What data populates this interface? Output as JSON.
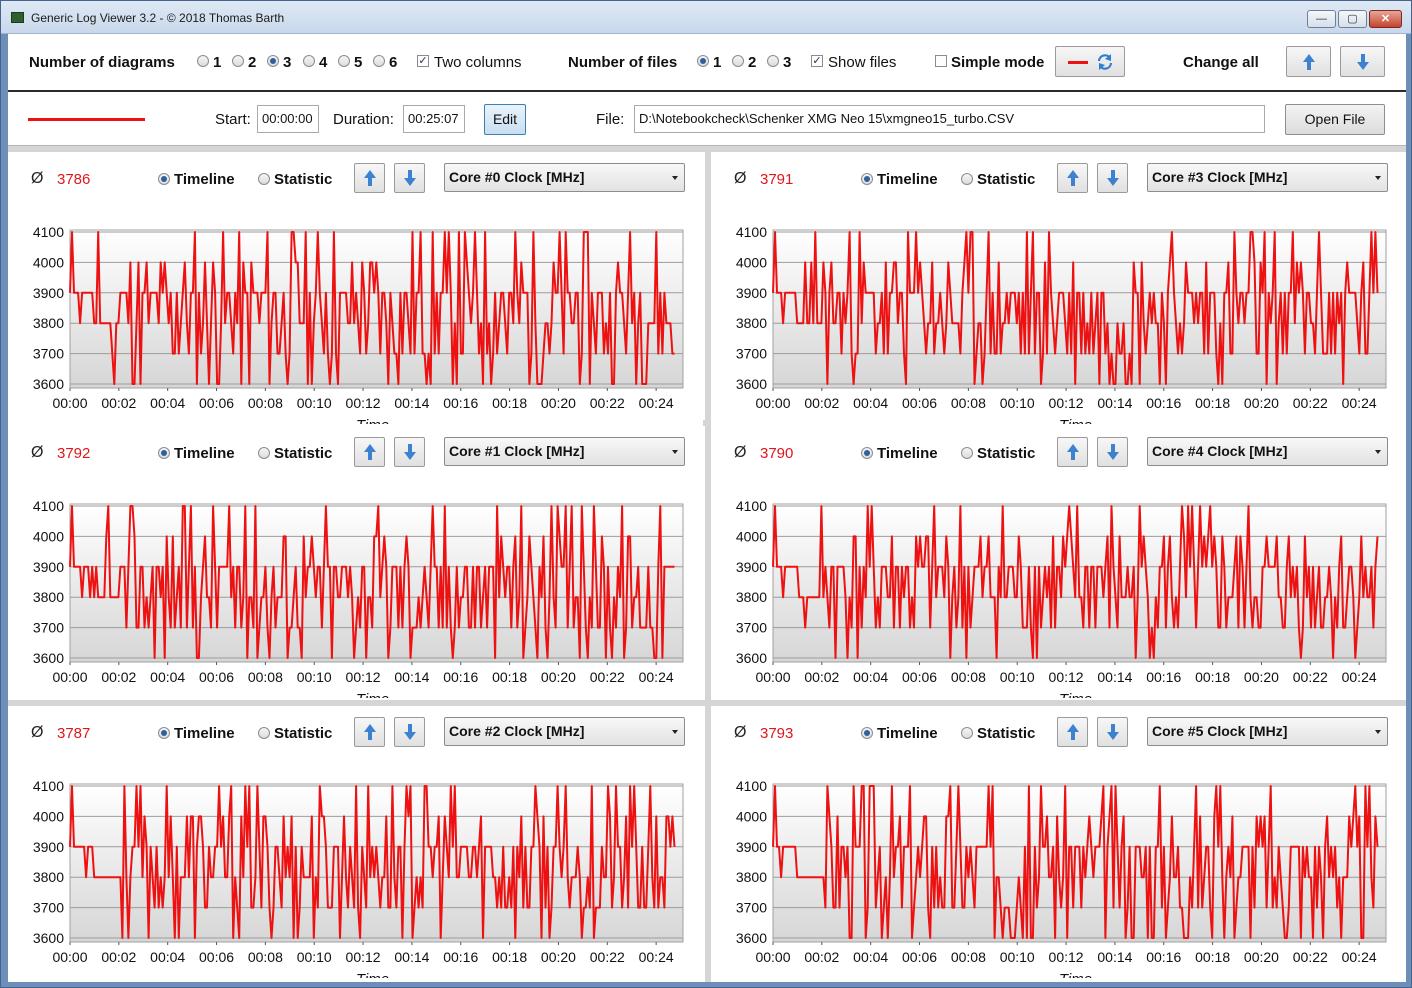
{
  "window": {
    "title": "Generic Log Viewer 3.2 - © 2018 Thomas Barth",
    "min": "—",
    "max": "▢",
    "close": "✕"
  },
  "toolbar": {
    "diagrams_label": "Number of diagrams",
    "diagram_options": [
      "1",
      "2",
      "3",
      "4",
      "5",
      "6"
    ],
    "diagram_selected": "3",
    "two_columns_label": "Two columns",
    "two_columns_checked": true,
    "files_label": "Number of files",
    "file_options": [
      "1",
      "2",
      "3"
    ],
    "file_selected": "1",
    "show_files_label": "Show files",
    "show_files_checked": true,
    "simple_mode_label": "Simple mode",
    "simple_mode_checked": false,
    "change_all_label": "Change all"
  },
  "fileinfo": {
    "start_label": "Start:",
    "start_value": "00:00:00",
    "duration_label": "Duration:",
    "duration_value": "00:25:07",
    "edit_label": "Edit",
    "file_label": "File:",
    "file_path": "D:\\Notebookcheck\\Schenker XMG Neo 15\\xmgneo15_turbo.CSV",
    "open_file_label": "Open File",
    "line_color": "#ee1111"
  },
  "panel_labels": {
    "avg_symbol": "Ø",
    "timeline": "Timeline",
    "statistic": "Statistic",
    "x_axis": "Time"
  },
  "accent": {
    "series": "#ee1111",
    "avg": "#e0161b",
    "arrow": "#3c82d0"
  },
  "chart_data": [
    {
      "type": "line",
      "sensor": "Core #0 Clock [MHz]",
      "average": "3786",
      "mode": "Timeline",
      "xlabel": "Time",
      "ylim": [
        3600,
        4100
      ],
      "yticks": [
        3600,
        3700,
        3800,
        3900,
        4000,
        4100
      ],
      "xticks": [
        "00:00",
        "00:02",
        "00:04",
        "00:06",
        "00:08",
        "00:10",
        "00:12",
        "00:14",
        "00:16",
        "00:18",
        "00:20",
        "00:22",
        "00:24"
      ],
      "xlim_min": [
        0,
        25.1
      ],
      "series": [
        {
          "color": "#ee1111",
          "seed": 11
        }
      ]
    },
    {
      "type": "line",
      "sensor": "Core #3 Clock [MHz]",
      "average": "3791",
      "mode": "Timeline",
      "xlabel": "Time",
      "ylim": [
        3600,
        4100
      ],
      "yticks": [
        3600,
        3700,
        3800,
        3900,
        4000,
        4100
      ],
      "xticks": [
        "00:00",
        "00:02",
        "00:04",
        "00:06",
        "00:08",
        "00:10",
        "00:12",
        "00:14",
        "00:16",
        "00:18",
        "00:20",
        "00:22",
        "00:24"
      ],
      "xlim_min": [
        0,
        25.1
      ],
      "series": [
        {
          "color": "#ee1111",
          "seed": 23
        }
      ]
    },
    {
      "type": "line",
      "sensor": "Core #1 Clock [MHz]",
      "average": "3792",
      "mode": "Timeline",
      "xlabel": "Time",
      "ylim": [
        3600,
        4100
      ],
      "yticks": [
        3600,
        3700,
        3800,
        3900,
        4000,
        4100
      ],
      "xticks": [
        "00:00",
        "00:02",
        "00:04",
        "00:06",
        "00:08",
        "00:10",
        "00:12",
        "00:14",
        "00:16",
        "00:18",
        "00:20",
        "00:22",
        "00:24"
      ],
      "xlim_min": [
        0,
        25.1
      ],
      "series": [
        {
          "color": "#ee1111",
          "seed": 37
        }
      ]
    },
    {
      "type": "line",
      "sensor": "Core #4 Clock [MHz]",
      "average": "3790",
      "mode": "Timeline",
      "xlabel": "Time",
      "ylim": [
        3600,
        4100
      ],
      "yticks": [
        3600,
        3700,
        3800,
        3900,
        4000,
        4100
      ],
      "xticks": [
        "00:00",
        "00:02",
        "00:04",
        "00:06",
        "00:08",
        "00:10",
        "00:12",
        "00:14",
        "00:16",
        "00:18",
        "00:20",
        "00:22",
        "00:24"
      ],
      "xlim_min": [
        0,
        25.1
      ],
      "series": [
        {
          "color": "#ee1111",
          "seed": 41
        }
      ]
    },
    {
      "type": "line",
      "sensor": "Core #2 Clock [MHz]",
      "average": "3787",
      "mode": "Timeline",
      "xlabel": "Time",
      "ylim": [
        3600,
        4100
      ],
      "yticks": [
        3600,
        3700,
        3800,
        3900,
        4000,
        4100
      ],
      "xticks": [
        "00:00",
        "00:02",
        "00:04",
        "00:06",
        "00:08",
        "00:10",
        "00:12",
        "00:14",
        "00:16",
        "00:18",
        "00:20",
        "00:22",
        "00:24"
      ],
      "xlim_min": [
        0,
        25.1
      ],
      "series": [
        {
          "color": "#ee1111",
          "seed": 53
        }
      ]
    },
    {
      "type": "line",
      "sensor": "Core #5 Clock [MHz]",
      "average": "3793",
      "mode": "Timeline",
      "xlabel": "Time",
      "ylim": [
        3600,
        4100
      ],
      "yticks": [
        3600,
        3700,
        3800,
        3900,
        4000,
        4100
      ],
      "xticks": [
        "00:00",
        "00:02",
        "00:04",
        "00:06",
        "00:08",
        "00:10",
        "00:12",
        "00:14",
        "00:16",
        "00:18",
        "00:20",
        "00:22",
        "00:24"
      ],
      "xlim_min": [
        0,
        25.1
      ],
      "series": [
        {
          "color": "#ee1111",
          "seed": 67
        }
      ]
    }
  ]
}
